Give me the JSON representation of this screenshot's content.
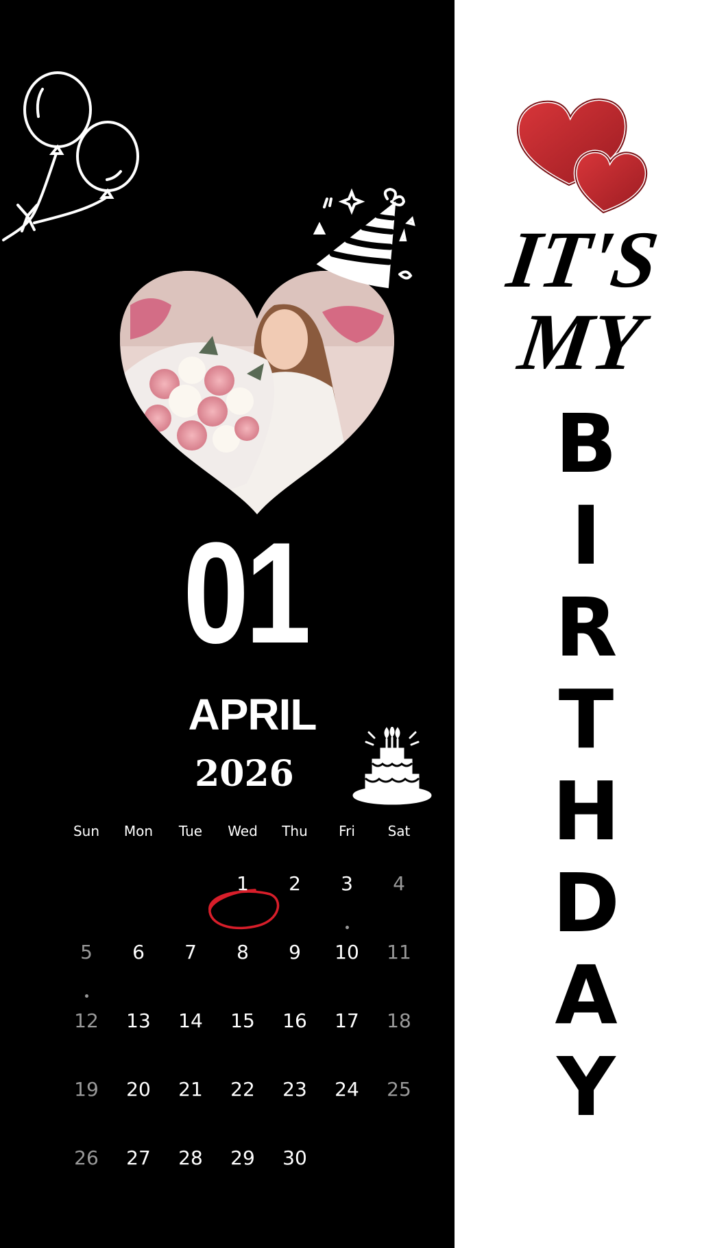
{
  "date": {
    "day": "01",
    "month": "APRIL",
    "year": "2026"
  },
  "calendar": {
    "weekdays": [
      "Sun",
      "Mon",
      "Tue",
      "Wed",
      "Thu",
      "Fri",
      "Sat"
    ],
    "weeks": [
      [
        "",
        "",
        "",
        "1",
        "2",
        "3",
        "4"
      ],
      [
        "5",
        "6",
        "7",
        "8",
        "9",
        "10",
        "11"
      ],
      [
        "12",
        "13",
        "14",
        "15",
        "16",
        "17",
        "18"
      ],
      [
        "19",
        "20",
        "21",
        "22",
        "23",
        "24",
        "25"
      ],
      [
        "26",
        "27",
        "28",
        "29",
        "30",
        "",
        ""
      ]
    ],
    "circled_day": "1",
    "marked_days": [
      "3",
      "5"
    ]
  },
  "banner": {
    "line1": "IT'S",
    "line2": "MY",
    "word": "BIRTHDAY"
  },
  "colors": {
    "background_left": "#000000",
    "background_right": "#ffffff",
    "circle_accent": "#d81e2a",
    "heart_red": "#c0262c",
    "weekend_grey": "#9a9a9a"
  },
  "icons": [
    "balloons-icon",
    "party-hat-icon",
    "birthday-cake-icon",
    "double-heart-icon"
  ]
}
